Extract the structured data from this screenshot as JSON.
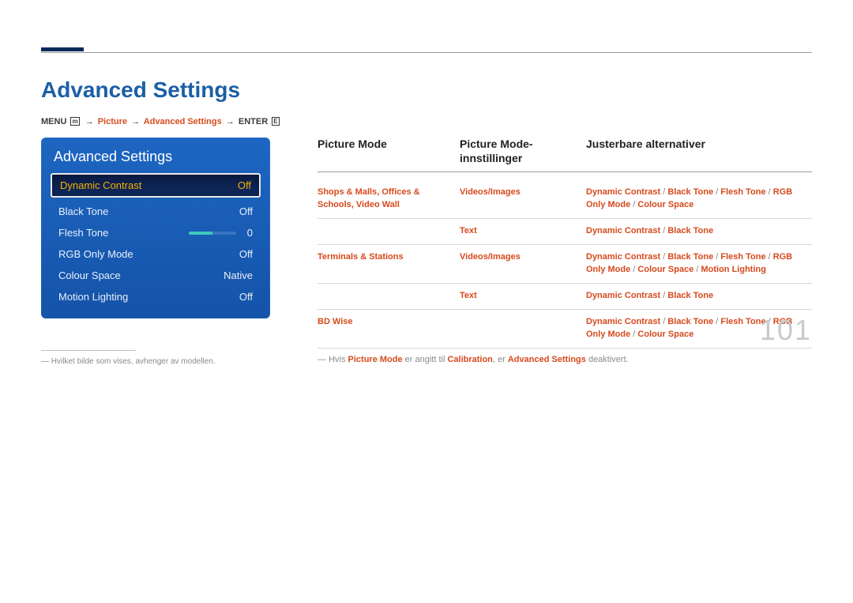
{
  "heading": "Advanced Settings",
  "breadcrumb": {
    "menu_label": "MENU",
    "menu_icon": "m",
    "path1": "Picture",
    "path2": "Advanced Settings",
    "enter_label": "ENTER",
    "enter_icon": "E"
  },
  "osd": {
    "title": "Advanced Settings",
    "rows": [
      {
        "label": "Dynamic Contrast",
        "value": "Off",
        "selected": true
      },
      {
        "label": "Black Tone",
        "value": "Off"
      },
      {
        "label": "Flesh Tone",
        "value": "0",
        "slider": true
      },
      {
        "label": "RGB Only Mode",
        "value": "Off"
      },
      {
        "label": "Colour Space",
        "value": "Native"
      },
      {
        "label": "Motion Lighting",
        "value": "Off"
      }
    ]
  },
  "footnote": "Hvilket bilde som vises, avhenger av modellen.",
  "table": {
    "headers": {
      "c1": "Picture Mode",
      "c2": "Picture Mode-innstillinger",
      "c3": "Justerbare alternativer"
    },
    "rows": [
      {
        "c1": [
          "Shops & Malls",
          "Offices & Schools",
          "Video Wall"
        ],
        "c2": "Videos/Images",
        "c3": [
          "Dynamic Contrast",
          "Black Tone",
          "Flesh Tone",
          "RGB Only Mode",
          "Colour Space"
        ]
      },
      {
        "c1": "",
        "c2": "Text",
        "c3": [
          "Dynamic Contrast",
          "Black Tone"
        ]
      },
      {
        "c1": [
          "Terminals & Stations"
        ],
        "c2": "Videos/Images",
        "c3": [
          "Dynamic Contrast",
          "Black Tone",
          "Flesh Tone",
          "RGB Only Mode",
          "Colour Space",
          "Motion Lighting"
        ]
      },
      {
        "c1": "",
        "c2": "Text",
        "c3": [
          "Dynamic Contrast",
          "Black Tone"
        ]
      },
      {
        "c1": [
          "BD Wise"
        ],
        "c2": "",
        "c3": [
          "Dynamic Contrast",
          "Black Tone",
          "Flesh Tone",
          "RGB Only Mode",
          "Colour Space"
        ]
      }
    ]
  },
  "note": {
    "pre": "Hvis ",
    "hl1": "Picture Mode",
    "mid1": " er angitt til ",
    "hl2": "Calibration",
    "mid2": ", er ",
    "hl3": "Advanced Settings",
    "post": " deaktivert."
  },
  "page_number": "101"
}
